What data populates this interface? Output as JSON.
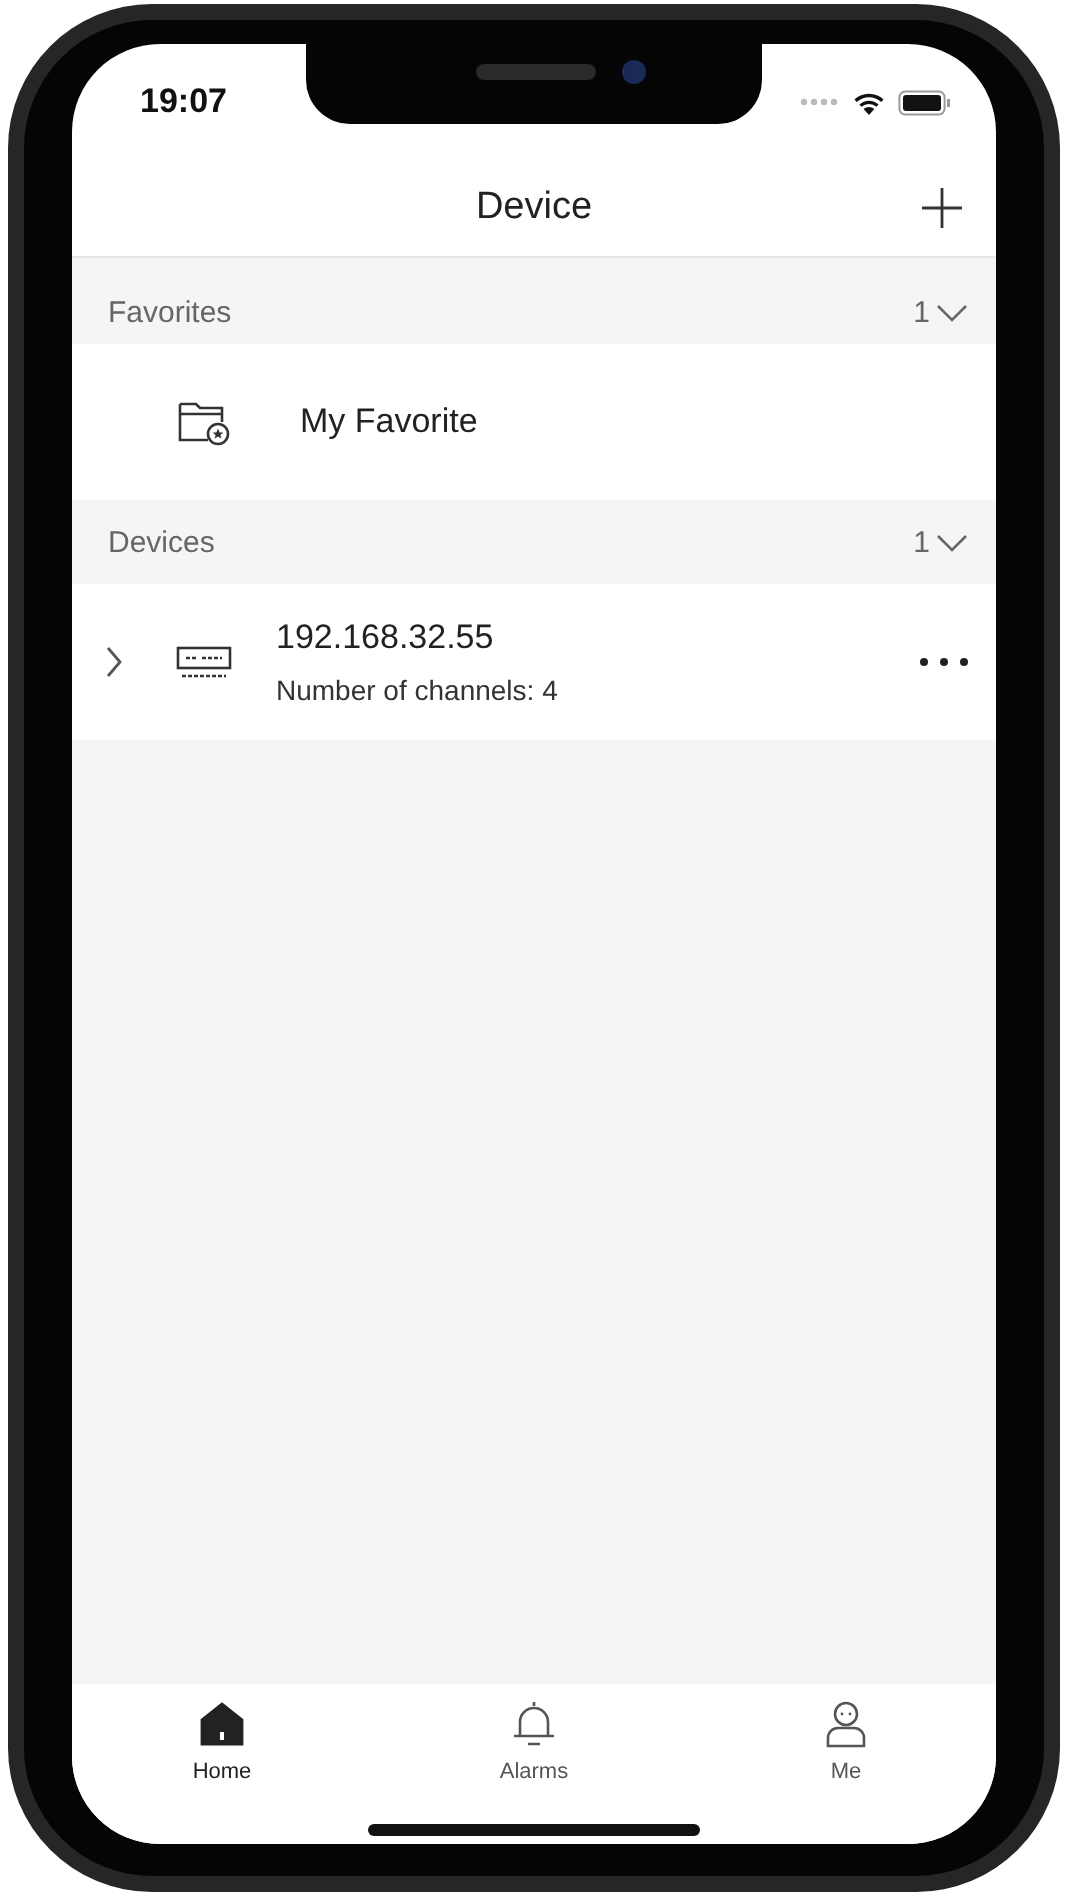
{
  "status_bar": {
    "time": "19:07"
  },
  "nav": {
    "title": "Device"
  },
  "sections": [
    {
      "title": "Favorites",
      "count": "1",
      "items": [
        {
          "kind": "favorite",
          "name": "My Favorite"
        }
      ]
    },
    {
      "title": "Devices",
      "count": "1",
      "items": [
        {
          "kind": "device",
          "name": "192.168.32.55",
          "detail": "Number of channels: 4"
        }
      ]
    }
  ],
  "tabs": [
    {
      "label": "Home",
      "kind": "home",
      "selected": true
    },
    {
      "label": "Alarms",
      "kind": "bell",
      "selected": false
    },
    {
      "label": "Me",
      "kind": "person",
      "selected": false
    }
  ]
}
